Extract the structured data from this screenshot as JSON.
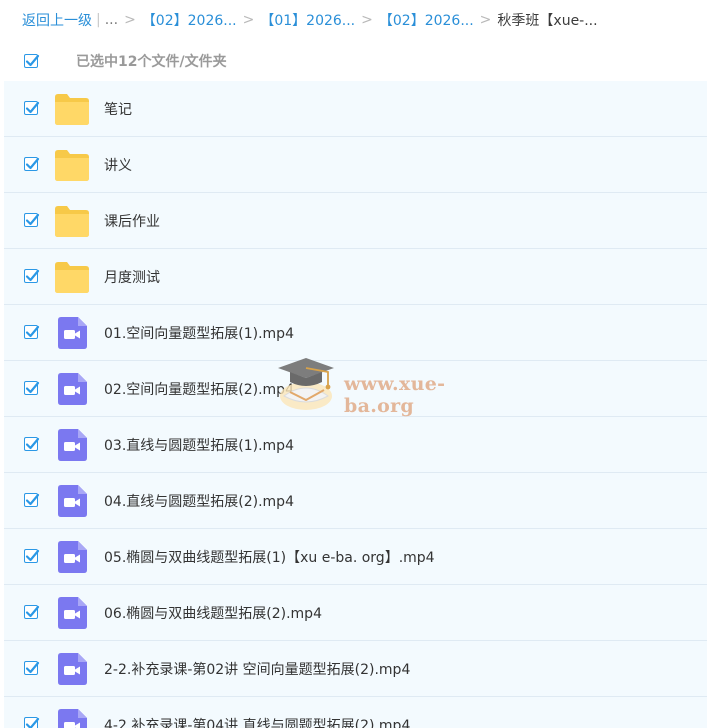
{
  "breadcrumb": {
    "back_label": "返回上一级",
    "ellipsis": "...",
    "items": [
      "【02】2026...",
      "【01】2026...",
      "【02】2026..."
    ],
    "current": "秋季班【xue-..."
  },
  "selection": {
    "summary": "已选中12个文件/文件夹"
  },
  "files": [
    {
      "name": "笔记",
      "type": "folder",
      "checked": true
    },
    {
      "name": "讲义",
      "type": "folder",
      "checked": true
    },
    {
      "name": "课后作业",
      "type": "folder",
      "checked": true
    },
    {
      "name": "月度测试",
      "type": "folder",
      "checked": true
    },
    {
      "name": "01.空间向量题型拓展(1).mp4",
      "type": "video",
      "checked": true
    },
    {
      "name": "02.空间向量题型拓展(2).mp4",
      "type": "video",
      "checked": true
    },
    {
      "name": "03.直线与圆题型拓展(1).mp4",
      "type": "video",
      "checked": true
    },
    {
      "name": "04.直线与圆题型拓展(2).mp4",
      "type": "video",
      "checked": true
    },
    {
      "name": "05.椭圆与双曲线题型拓展(1)【xu e-ba. org】.mp4",
      "type": "video",
      "checked": true
    },
    {
      "name": "06.椭圆与双曲线题型拓展(2).mp4",
      "type": "video",
      "checked": true
    },
    {
      "name": "2-2.补充录课-第02讲 空间向量题型拓展(2).mp4",
      "type": "video",
      "checked": true
    },
    {
      "name": "4-2.补充录课-第04讲 直线与圆题型拓展(2).mp4",
      "type": "video",
      "checked": true
    }
  ],
  "watermark": {
    "text": "www.xue-ba.org",
    "icon": "graduation-cap-icon"
  },
  "colors": {
    "accent": "#2a8fd8",
    "checkbox": "#2b98e6",
    "row_bg": "#f3fafe",
    "row_border": "#dfeaf3",
    "folder": "#ffd867",
    "video": "#7b78f0",
    "watermark": "#e3b79a"
  }
}
